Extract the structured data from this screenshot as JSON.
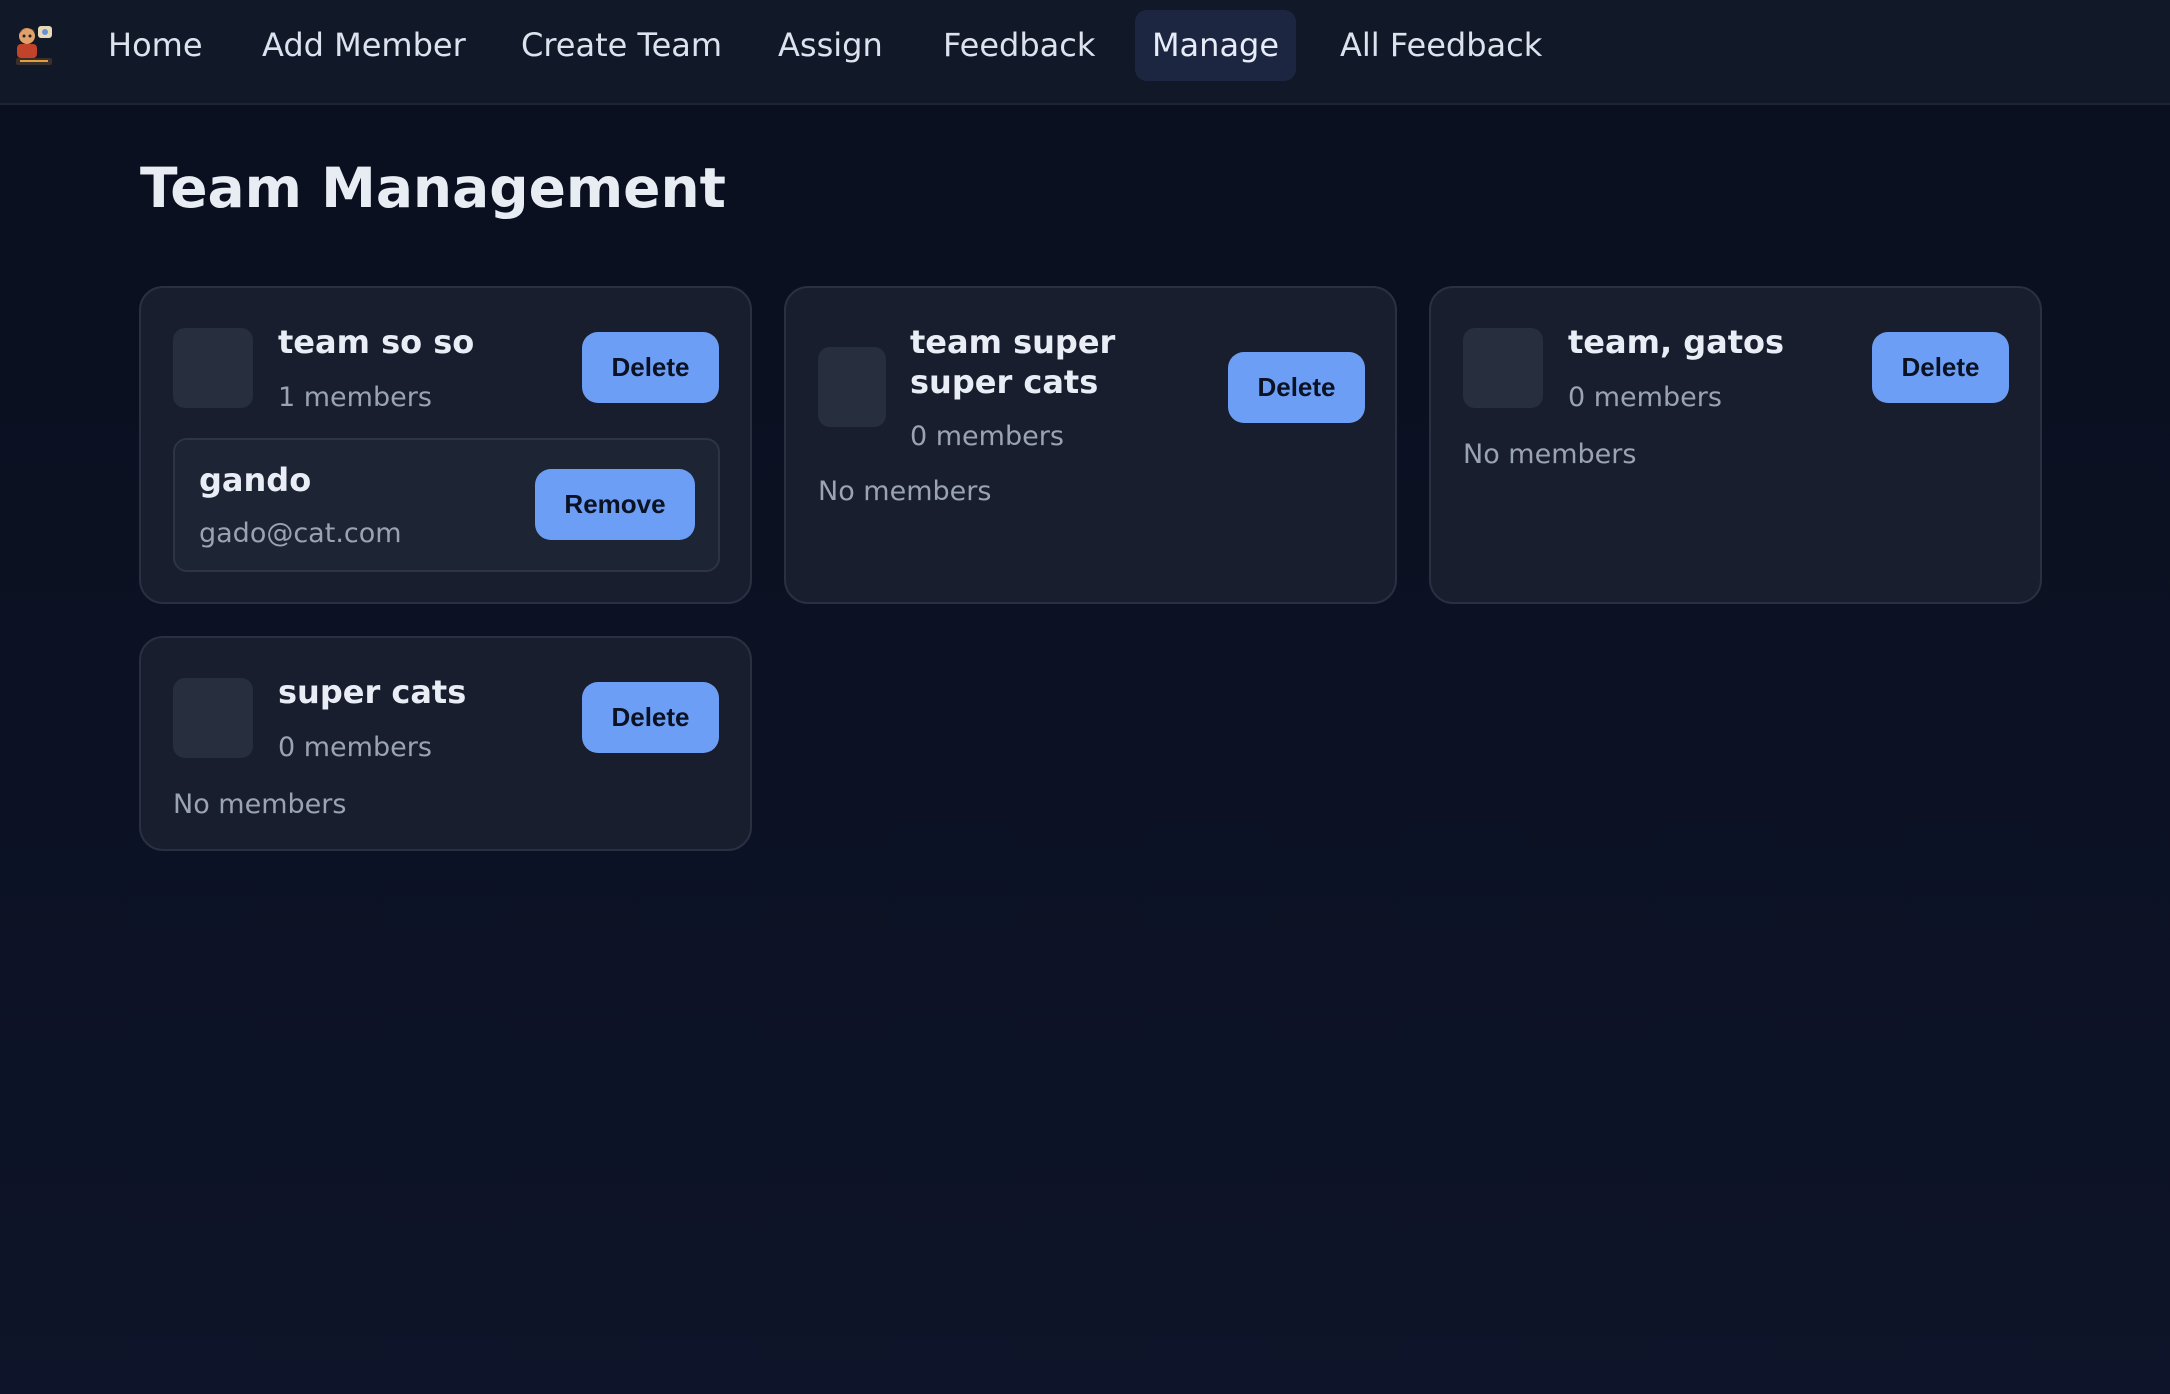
{
  "nav": {
    "items": [
      {
        "label": "Home"
      },
      {
        "label": "Add Member"
      },
      {
        "label": "Create Team"
      },
      {
        "label": "Assign"
      },
      {
        "label": "Feedback"
      },
      {
        "label": "Manage",
        "active": true
      },
      {
        "label": "All Feedback"
      }
    ],
    "logo_icon": "cartoon-character-logo"
  },
  "page": {
    "title": "Team Management"
  },
  "teams": [
    {
      "name": "team so so",
      "count": "1 members",
      "delete_label": "Delete",
      "members": [
        {
          "name": "gando",
          "email": "gado@cat.com",
          "remove_label": "Remove"
        }
      ]
    },
    {
      "name": "team super super cats",
      "count": "0 members",
      "delete_label": "Delete",
      "empty_text": "No members"
    },
    {
      "name": "team, gatos",
      "count": "0 members",
      "delete_label": "Delete",
      "empty_text": "No members"
    },
    {
      "name": "super cats",
      "count": "0 members",
      "delete_label": "Delete",
      "empty_text": "No members"
    }
  ],
  "colors": {
    "background": "#0a0f1e",
    "navbar": "#111827",
    "card": "#181e2d",
    "accent_button": "#6d9ef6",
    "active_nav": "#1c2640"
  }
}
